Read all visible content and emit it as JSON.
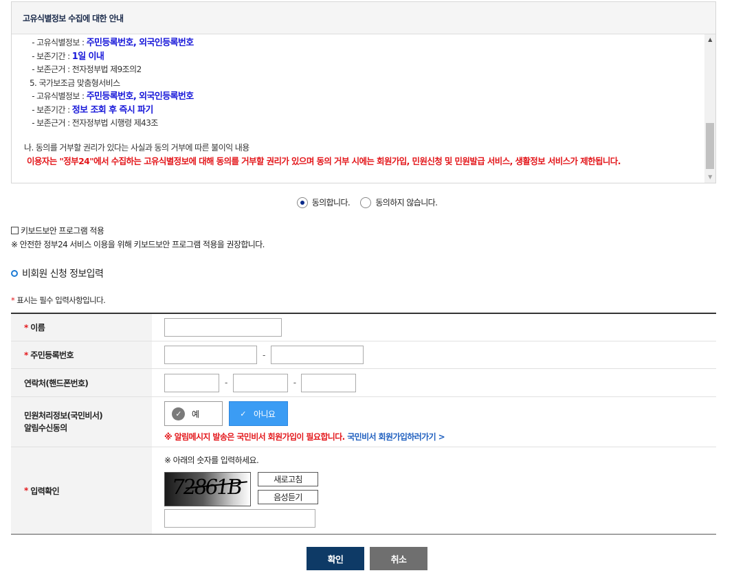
{
  "notice": {
    "title": "고유식별정보 수집에 대한 안내",
    "lines": [
      {
        "prefix": "- 고유식별정보 : ",
        "value": "주민등록번호, 외국인등록번호"
      },
      {
        "prefix": "- 보존기간 : ",
        "value": "1일 이내"
      },
      {
        "prefix": "- 보존근거 : 전자정부법 제9조의2",
        "value": ""
      },
      {
        "prefix": "5. 국가보조금 맞춤형서비스",
        "value": ""
      },
      {
        "prefix": "- 고유식별정보 : ",
        "value": "주민등록번호, 외국인등록번호"
      },
      {
        "prefix": "- 보존기간 : ",
        "value": "정보 조회 후 즉시 파기"
      },
      {
        "prefix": "- 보존근거 : 전자정부법 시행령 제43조",
        "value": ""
      }
    ],
    "refusal_heading": "나. 동의를 거부할 권리가 있다는 사실과 동의 거부에 따른 불이익 내용",
    "refusal_text": "이용자는 \"정부24\"에서 수집하는 고유식별정보에 대해 동의를 거부할 권리가 있으며 동의 거부 시에는 회원가입, 민원신청 및 민원발급 서비스, 생활정보 서비스가 제한됩니다.",
    "scroll_up": "▲",
    "scroll_down": "▼"
  },
  "agreement": {
    "agree_label": "동의합니다.",
    "disagree_label": "동의하지 않습니다.",
    "selected": "agree"
  },
  "keyboard": {
    "checkbox_label": "키보드보안 프로그램 적용",
    "note": "※ 안전한 정부24 서비스 이용을 위해 키보드보안 프로그램 적용을 권장합니다."
  },
  "section": {
    "title": "비회원 신청 정보입력",
    "required_mark": "*",
    "required_note": " 표시는 필수 입력사항입니다."
  },
  "form": {
    "name_label": "이름",
    "rrn_label": "주민등록번호",
    "phone_label": "연락처(핸드폰번호)",
    "dash": "-",
    "notify_label_line1": "민원처리정보(국민비서)",
    "notify_label_line2": "알림수신동의",
    "yes_label": "예",
    "no_label": "아니요",
    "notify_selected": "no",
    "notify_note": "※ 알림메시지 발송은 국민비서 회원가입이 필요합니다.",
    "notify_link": "국민비서 회원가입하러가기 >",
    "captcha_label": "입력확인",
    "captcha_instruction": "※ 아래의 숫자를 입력하세요.",
    "captcha_text": "72861B",
    "refresh_label": "새로고침",
    "audio_label": "음성듣기"
  },
  "buttons": {
    "confirm": "확인",
    "cancel": "취소"
  },
  "colors": {
    "highlight_blue": "#1717d9",
    "warning_red": "#e3171b",
    "primary_navy": "#0e3a66",
    "toggle_blue": "#3b9cf4"
  }
}
